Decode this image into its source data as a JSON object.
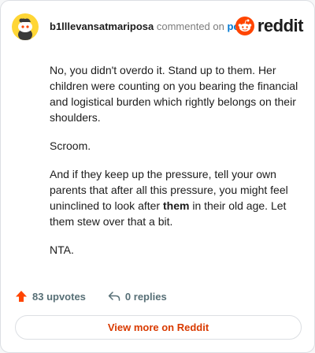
{
  "header": {
    "username": "b1lllevansatmariposa",
    "action_text": "commented on",
    "post_link": "post",
    "brand_name": "reddit"
  },
  "comment": {
    "paragraph1": "No, you didn't overdo it. Stand up to them. Her children were counting on you bearing the financial and logistical burden which rightly belongs on their shoulders.",
    "paragraph2": "Scroom.",
    "paragraph3_before": "And if they keep up the pressure, tell your own parents that after all this pressure, you might feel uninclined to look after ",
    "paragraph3_bold": "them",
    "paragraph3_after": " in their old age. Let them stew over that a bit.",
    "paragraph4": "NTA."
  },
  "actions": {
    "upvotes": "83 upvotes",
    "replies": "0 replies"
  },
  "footer": {
    "view_more_label": "View more on Reddit"
  },
  "colors": {
    "accent": "#d93a00",
    "reddit_orange": "#ff4500",
    "link_blue": "#0079d3",
    "avatar_bg": "#ffd635"
  },
  "icons": {
    "avatar": "snoo-avatar-icon",
    "brand": "reddit-logo-icon",
    "upvote": "upvote-arrow-icon",
    "reply": "reply-arrow-icon"
  }
}
